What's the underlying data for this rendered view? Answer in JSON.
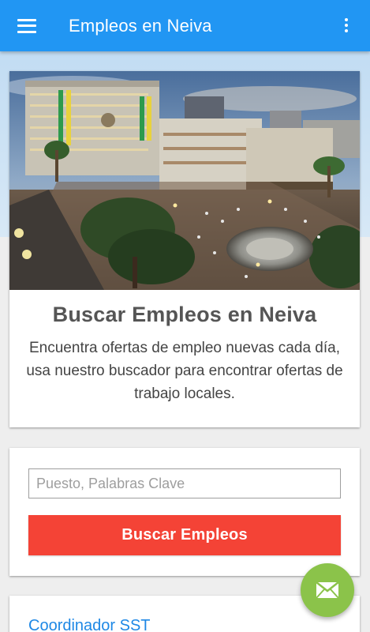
{
  "appbar": {
    "title": "Empleos en Neiva",
    "menu_icon": "hamburger-menu-icon",
    "overflow_icon": "more-vert-icon",
    "color": "#2196f3"
  },
  "hero": {
    "title": "Buscar Empleos en Neiva",
    "description": "Encuentra ofertas de empleo nuevas cada día, usa nuestro buscador para encontrar ofertas de trabajo locales."
  },
  "search": {
    "placeholder": "Puesto, Palabras Clave",
    "value": "",
    "button_label": "Buscar Empleos",
    "button_color": "#f44336"
  },
  "jobs": [
    {
      "title": "Coordinador SST"
    }
  ],
  "fab": {
    "icon": "mail-icon",
    "color": "#8bc34a"
  }
}
